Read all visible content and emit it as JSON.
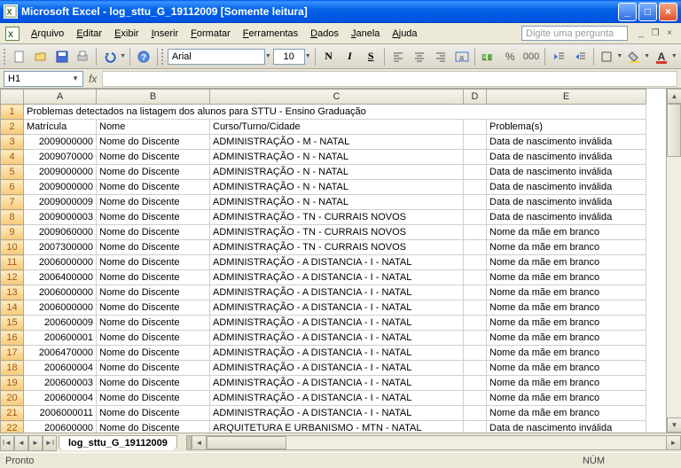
{
  "title": "Microsoft Excel - log_sttu_G_19112009  [Somente leitura]",
  "menus": [
    "Arquivo",
    "Editar",
    "Exibir",
    "Inserir",
    "Formatar",
    "Ferramentas",
    "Dados",
    "Janela",
    "Ajuda"
  ],
  "ask_placeholder": "Digite uma pergunta",
  "font": {
    "name": "Arial",
    "size": "10"
  },
  "namebox": "H1",
  "col_headers": [
    "A",
    "B",
    "C",
    "D",
    "E"
  ],
  "row1_merged": "Problemas detectados na listagem dos alunos para STTU  - Ensino Graduação",
  "header_row": {
    "A": "Matrícula",
    "B": "Nome",
    "C": "Curso/Turno/Cidade",
    "D": "",
    "E": "Problema(s)"
  },
  "rows": [
    {
      "n": "3",
      "A": "2009000000",
      "B": "Nome do Discente",
      "C": "ADMINISTRAÇÃO - M - NATAL",
      "E": "Data de nascimento inválida"
    },
    {
      "n": "4",
      "A": "2009070000",
      "B": "Nome do Discente",
      "C": "ADMINISTRAÇÃO - N - NATAL",
      "E": "Data de nascimento inválida"
    },
    {
      "n": "5",
      "A": "2009000000",
      "B": "Nome do Discente",
      "C": "ADMINISTRAÇÃO - N - NATAL",
      "E": "Data de nascimento inválida"
    },
    {
      "n": "6",
      "A": "2009000000",
      "B": "Nome do Discente",
      "C": "ADMINISTRAÇÃO - N - NATAL",
      "E": "Data de nascimento inválida"
    },
    {
      "n": "7",
      "A": "2009000009",
      "B": "Nome do Discente",
      "C": "ADMINISTRAÇÃO - N - NATAL",
      "E": "Data de nascimento inválida"
    },
    {
      "n": "8",
      "A": "2009000003",
      "B": "Nome do Discente",
      "C": "ADMINISTRAÇÃO - TN - CURRAIS NOVOS",
      "E": "Data de nascimento inválida"
    },
    {
      "n": "9",
      "A": "2009060000",
      "B": "Nome do Discente",
      "C": "ADMINISTRAÇÃO - TN - CURRAIS NOVOS",
      "E": "Nome da mãe em branco"
    },
    {
      "n": "10",
      "A": "2007300000",
      "B": "Nome do Discente",
      "C": "ADMINISTRAÇÃO - TN - CURRAIS NOVOS",
      "E": "Nome da mãe em branco"
    },
    {
      "n": "11",
      "A": "2006000000",
      "B": "Nome do Discente",
      "C": "ADMINISTRAÇÃO - A DISTANCIA - I - NATAL",
      "E": "Nome da mãe em branco"
    },
    {
      "n": "12",
      "A": "2006400000",
      "B": "Nome do Discente",
      "C": "ADMINISTRAÇÃO - A DISTANCIA - I - NATAL",
      "E": "Nome da mãe em branco"
    },
    {
      "n": "13",
      "A": "2006000000",
      "B": "Nome do Discente",
      "C": "ADMINISTRAÇÃO - A DISTANCIA - I - NATAL",
      "E": "Nome da mãe em branco"
    },
    {
      "n": "14",
      "A": "2006000000",
      "B": "Nome do Discente",
      "C": "ADMINISTRAÇÃO - A DISTANCIA - I - NATAL",
      "E": "Nome da mãe em branco"
    },
    {
      "n": "15",
      "A": "200600009",
      "B": "Nome do Discente",
      "C": "ADMINISTRAÇÃO - A DISTANCIA - I - NATAL",
      "E": "Nome da mãe em branco"
    },
    {
      "n": "16",
      "A": "200600001",
      "B": "Nome do Discente",
      "C": "ADMINISTRAÇÃO - A DISTANCIA - I - NATAL",
      "E": "Nome da mãe em branco"
    },
    {
      "n": "17",
      "A": "2006470000",
      "B": "Nome do Discente",
      "C": "ADMINISTRAÇÃO - A DISTANCIA - I - NATAL",
      "E": "Nome da mãe em branco"
    },
    {
      "n": "18",
      "A": "200600004",
      "B": "Nome do Discente",
      "C": "ADMINISTRAÇÃO - A DISTANCIA - I - NATAL",
      "E": "Nome da mãe em branco"
    },
    {
      "n": "19",
      "A": "200600003",
      "B": "Nome do Discente",
      "C": "ADMINISTRAÇÃO - A DISTANCIA - I - NATAL",
      "E": "Nome da mãe em branco"
    },
    {
      "n": "20",
      "A": "200600004",
      "B": "Nome do Discente",
      "C": "ADMINISTRAÇÃO - A DISTANCIA - I - NATAL",
      "E": "Nome da mãe em branco"
    },
    {
      "n": "21",
      "A": "2006000011",
      "B": "Nome do Discente",
      "C": "ADMINISTRAÇÃO - A DISTANCIA - I - NATAL",
      "E": "Nome da mãe em branco"
    },
    {
      "n": "22",
      "A": "200600000",
      "B": "Nome do Discente",
      "C": "ARQUITETURA E URBANISMO - MTN - NATAL",
      "E": "Data de nascimento inválida"
    }
  ],
  "sheet_tab": "log_sttu_G_19112009",
  "status_left": "Pronto",
  "status_right": "NÚM"
}
